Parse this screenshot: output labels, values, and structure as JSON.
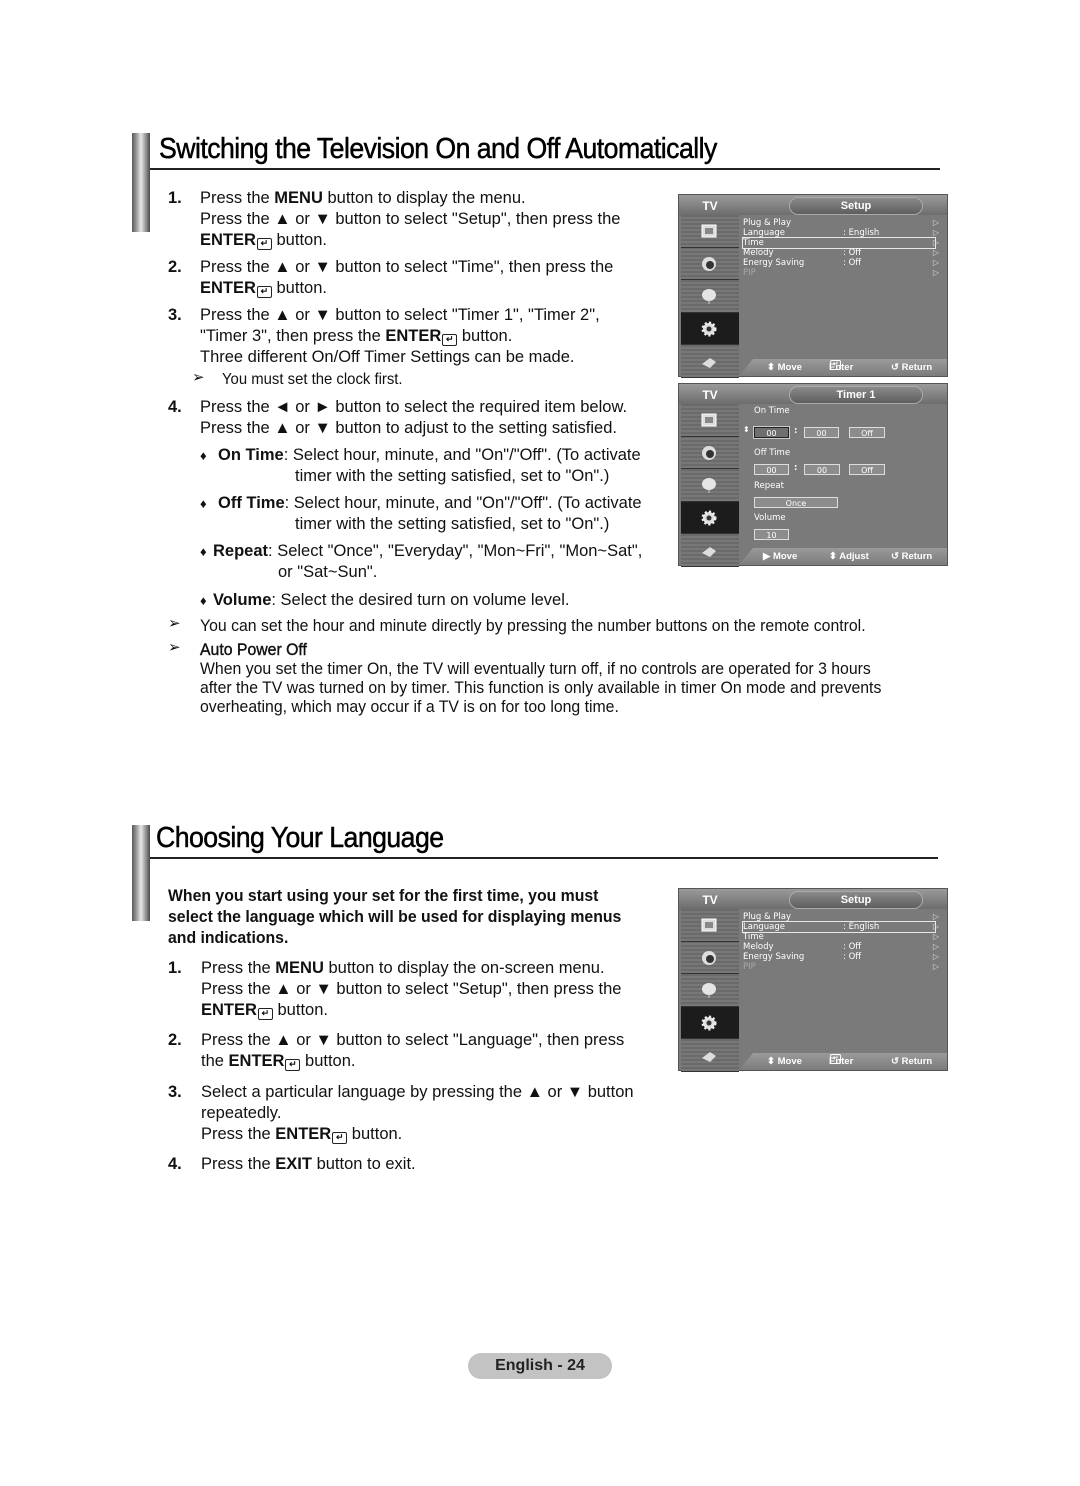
{
  "section1": {
    "title": "Switching the Television On and Off Automatically",
    "steps": [
      {
        "num": "1.",
        "lines": [
          "Press the |MENU| button to display the menu.",
          "Press the ▲ or ▼ button to select \"Setup\", then press the",
          "|ENTER| button."
        ]
      },
      {
        "num": "2.",
        "lines": [
          "Press the ▲ or ▼ button to select \"Time\", then press the",
          "|ENTER| button."
        ]
      },
      {
        "num": "3.",
        "lines": [
          "Press the ▲ or ▼ button to select \"Timer 1\", \"Timer 2\",",
          "\"Timer 3\", then press the |ENTER| button.",
          "Three different On/Off Timer Settings can be made."
        ]
      },
      {
        "num": "4.",
        "lines": [
          "Press the ◄ or ► button to select the required item below.",
          "Press the ▲ or ▼ button to adjust to the setting satisfied."
        ]
      }
    ],
    "step1_l1a": "Press the ",
    "step1_l1b": "MENU",
    "step1_l1c": " button to display the menu.",
    "step1_l2": "Press the ▲ or ▼ button to select \"Setup\", then press the",
    "enter_label": "ENTER",
    "button_word": " button.",
    "step2_l1": "Press the ▲ or ▼ button to select \"Time\", then press the",
    "step3_l1": "Press the ▲ or ▼ button to select \"Timer 1\", \"Timer 2\",",
    "step3_l2a": "\"Timer 3\", then press the ",
    "step3_l3": "Three different On/Off Timer Settings can be made.",
    "note_clock": "You must set the clock first.",
    "step4_l1": "Press the ◄ or ► button to select the required item below.",
    "step4_l2": "Press the ▲ or ▼ button to adjust to the setting satisfied.",
    "bullets": [
      {
        "term": "On Time",
        "text1": ": Select hour, minute, and \"On\"/\"Off\". (To activate",
        "text2": "timer with the setting satisfied, set to \"On\".)"
      },
      {
        "term": "Off Time",
        "text1": ": Select hour, minute, and \"On\"/\"Off\". (To activate",
        "text2": "timer with the setting satisfied, set to \"On\".)"
      },
      {
        "term": "Repeat",
        "text1": ": Select \"Once\", \"Everyday\", \"Mon~Fri\", \"Mon~Sat\",",
        "text2": "or \"Sat~Sun\"."
      },
      {
        "term": "Volume",
        "text1": ": Select the desired turn on volume level.",
        "text2": ""
      }
    ],
    "note_direct": "You can set the hour and minute directly by pressing the number buttons on the remote control.",
    "auto_power_off_title": "Auto Power Off",
    "auto_power_off_lines": [
      "When you set the timer On, the TV will eventually turn off, if no controls are operated for 3 hours",
      "after the TV was turned on by timer. This function is only available in timer On mode and prevents",
      "overheating, which may occur if a TV is on for too long time."
    ]
  },
  "section2": {
    "title": "Choosing Your Language",
    "intro_lines": [
      "When you start using your set for the first time, you must",
      "select the language which will be used for displaying menus",
      "and indications."
    ],
    "step1_l1a": "Press the ",
    "step1_l1b": "MENU",
    "step1_l1c": " button to display the on-screen menu.",
    "step1_l2": "Press the ▲ or ▼ button to select \"Setup\", then press the",
    "step2_l1": "Press the ▲ or ▼ button to select \"Language\", then press",
    "step2_l2a": "the ",
    "step3_l1": "Select a particular language by pressing the ▲ or ▼ button",
    "step3_l2": "repeatedly.",
    "step3_l3a": "Press the ",
    "step4_a": "Press the ",
    "step4_b": "EXIT",
    "step4_c": " button to exit.",
    "nums": [
      "1.",
      "2.",
      "3.",
      "4."
    ]
  },
  "nums": [
    "1.",
    "2.",
    "3.",
    "4."
  ],
  "bullet_glyph": "♦",
  "note_glyph": "➢",
  "osd_setup_1": {
    "tv_label": "TV",
    "title": "Setup",
    "selected": "Time",
    "rows": [
      {
        "label": "Plug & Play",
        "value": ""
      },
      {
        "label": "Language",
        "value": ": English"
      },
      {
        "label": "Time",
        "value": ""
      },
      {
        "label": "Melody",
        "value": ": Off"
      },
      {
        "label": "Energy Saving",
        "value": ": Off"
      },
      {
        "label": "PIP",
        "value": ""
      }
    ],
    "footer": {
      "move": "⬍ Move",
      "enter": "Enter",
      "return": "↺ Return"
    }
  },
  "osd_timer": {
    "tv_label": "TV",
    "title": "Timer 1",
    "on_time_label": "On Time",
    "on_hour": "00",
    "on_min": "00",
    "on_state": "Off",
    "off_time_label": "Off Time",
    "off_hour": "00",
    "off_min": "00",
    "off_state": "Off",
    "repeat_label": "Repeat",
    "repeat_value": "Once",
    "volume_label": "Volume",
    "volume_value": "10",
    "colon": ":",
    "footer": {
      "move": "▶ Move",
      "adjust": "⬍ Adjust",
      "return": "↺ Return"
    }
  },
  "osd_setup_2": {
    "tv_label": "TV",
    "title": "Setup",
    "selected": "Language",
    "rows": [
      {
        "label": "Plug & Play",
        "value": ""
      },
      {
        "label": "Language",
        "value": ": English"
      },
      {
        "label": "Time",
        "value": ""
      },
      {
        "label": "Melody",
        "value": ": Off"
      },
      {
        "label": "Energy Saving",
        "value": ": Off"
      },
      {
        "label": "PIP",
        "value": ""
      }
    ],
    "footer": {
      "move": "⬍ Move",
      "enter": "Enter",
      "return": "↺ Return"
    }
  },
  "footer": {
    "page_label": "English - 24"
  }
}
